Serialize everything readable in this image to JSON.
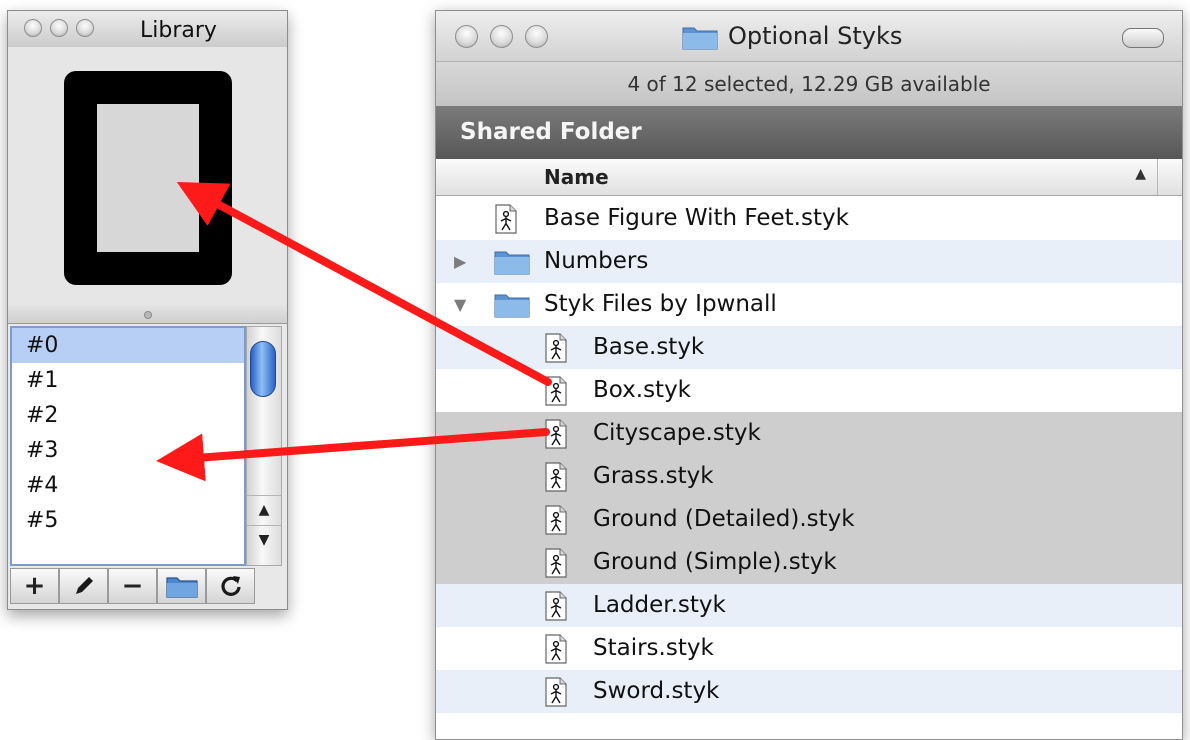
{
  "library": {
    "title": "Library",
    "items": [
      "#0",
      "#1",
      "#2",
      "#3",
      "#4",
      "#5"
    ],
    "selected_index": 0,
    "toolbar": {
      "add": "+",
      "remove": "−"
    }
  },
  "finder": {
    "title": "Optional Styks",
    "status": "4 of 12 selected, 12.29 GB available",
    "section": "Shared Folder",
    "column_name": "Name",
    "sort_indicator": "▲",
    "rows": [
      {
        "label": "Base Figure With Feet.styk",
        "kind": "file",
        "depth": 0,
        "selected": false
      },
      {
        "label": "Numbers",
        "kind": "folder",
        "depth": 0,
        "expanded": false,
        "selected": false
      },
      {
        "label": "Styk Files by Ipwnall",
        "kind": "folder",
        "depth": 0,
        "expanded": true,
        "selected": false
      },
      {
        "label": "Base.styk",
        "kind": "file",
        "depth": 1,
        "selected": false
      },
      {
        "label": "Box.styk",
        "kind": "file",
        "depth": 1,
        "selected": false
      },
      {
        "label": "Cityscape.styk",
        "kind": "file",
        "depth": 1,
        "selected": true
      },
      {
        "label": "Grass.styk",
        "kind": "file",
        "depth": 1,
        "selected": true
      },
      {
        "label": "Ground (Detailed).styk",
        "kind": "file",
        "depth": 1,
        "selected": true
      },
      {
        "label": "Ground (Simple).styk",
        "kind": "file",
        "depth": 1,
        "selected": true
      },
      {
        "label": "Ladder.styk",
        "kind": "file",
        "depth": 1,
        "selected": false
      },
      {
        "label": "Stairs.styk",
        "kind": "file",
        "depth": 1,
        "selected": false
      },
      {
        "label": "Sword.styk",
        "kind": "file",
        "depth": 1,
        "selected": false
      }
    ]
  },
  "icons": {
    "file": "stick-figure-file-icon",
    "folder": "folder-icon",
    "collapsed": "disclosure-collapsed-icon",
    "expanded": "disclosure-expanded-icon"
  },
  "colors": {
    "arrow": "#ff1a1a",
    "folder": "#7fb3e6",
    "selected_row": "#cecece",
    "alt_row": "#e9eff9",
    "library_selected": "#b7cff4",
    "section_bar": "#6a6a6a"
  },
  "disclosure": {
    "collapsed": "▶",
    "expanded": "▼"
  }
}
